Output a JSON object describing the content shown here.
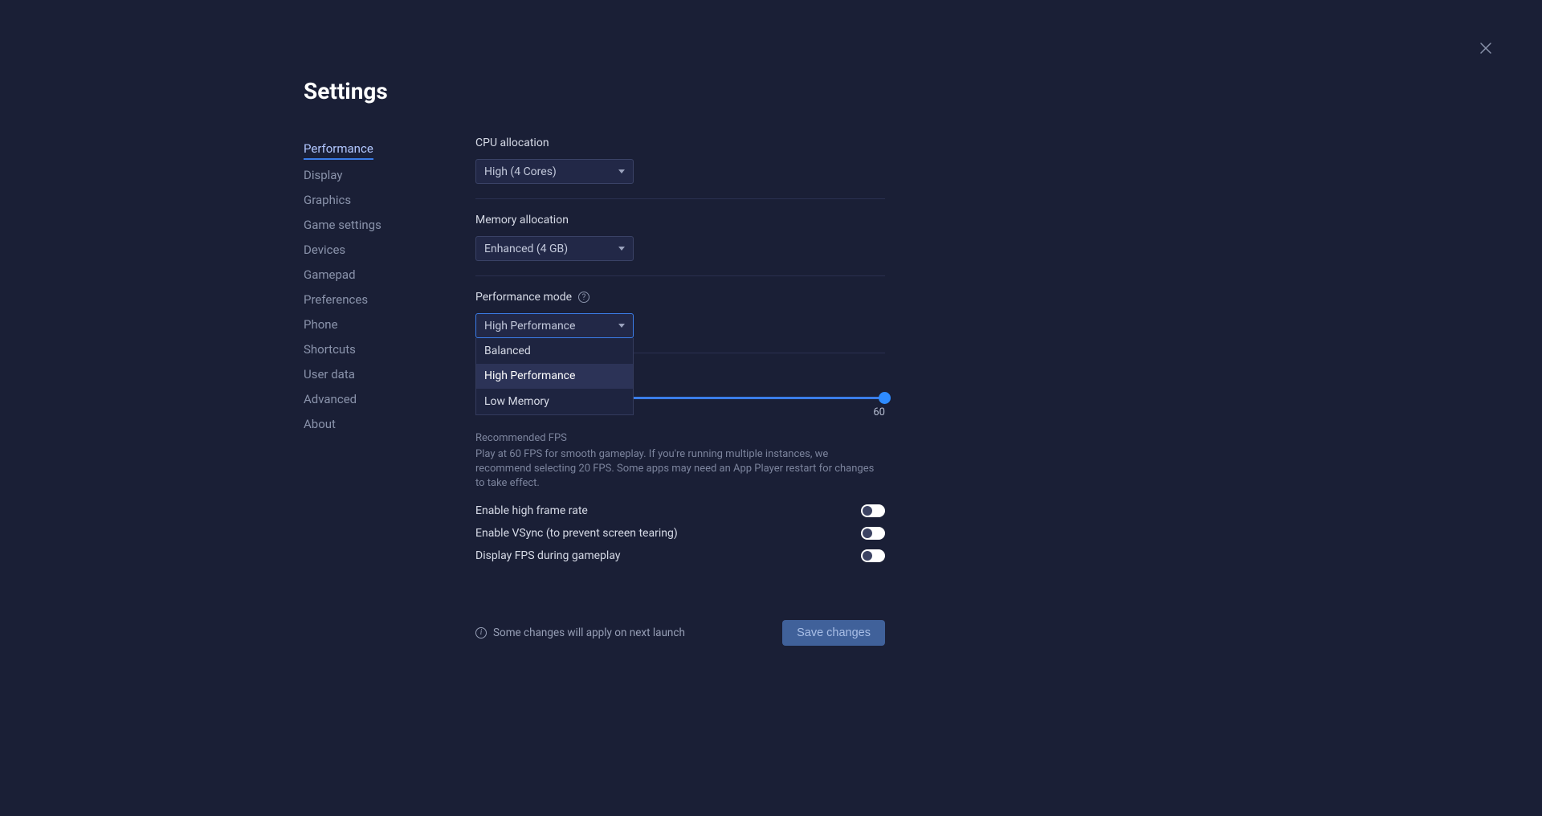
{
  "title": "Settings",
  "sidebar": {
    "items": [
      {
        "label": "Performance",
        "active": true
      },
      {
        "label": "Display"
      },
      {
        "label": "Graphics"
      },
      {
        "label": "Game settings"
      },
      {
        "label": "Devices"
      },
      {
        "label": "Gamepad"
      },
      {
        "label": "Preferences"
      },
      {
        "label": "Phone"
      },
      {
        "label": "Shortcuts"
      },
      {
        "label": "User data"
      },
      {
        "label": "Advanced"
      },
      {
        "label": "About"
      }
    ]
  },
  "cpu": {
    "label": "CPU allocation",
    "value": "High (4 Cores)"
  },
  "memory": {
    "label": "Memory allocation",
    "value": "Enhanced (4 GB)"
  },
  "perfmode": {
    "label": "Performance mode",
    "value": "High Performance",
    "options": [
      "Balanced",
      "High Performance",
      "Low Memory"
    ]
  },
  "fps": {
    "value": "60",
    "sub_heading": "Recommended FPS",
    "sub_desc": "Play at 60 FPS for smooth gameplay. If you're running multiple instances, we recommend selecting 20 FPS. Some apps may need an App Player restart for changes to take effect."
  },
  "toggles": {
    "highfr": "Enable high frame rate",
    "vsync": "Enable VSync (to prevent screen tearing)",
    "showfps": "Display FPS during gameplay"
  },
  "footer": {
    "notice": "Some changes will apply on next launch",
    "save": "Save changes"
  }
}
